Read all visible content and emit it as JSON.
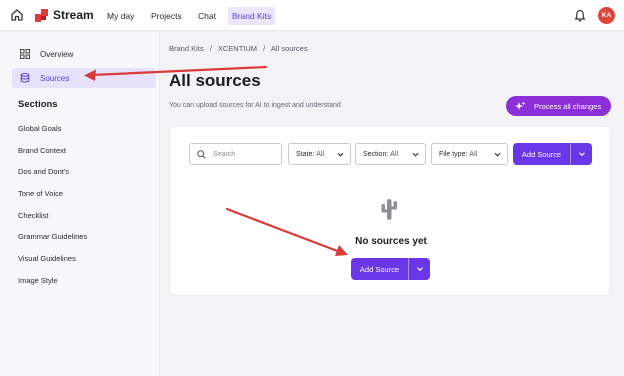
{
  "topbar": {
    "app_name": "Stream",
    "nav": [
      {
        "label": "My day"
      },
      {
        "label": "Projects"
      },
      {
        "label": "Chat"
      },
      {
        "label": "Brand Kits"
      }
    ],
    "active_nav": "Brand Kits",
    "avatar_initials": "KA",
    "avatar_color": "#e0453a"
  },
  "sidebar": {
    "links": [
      {
        "label": "Overview",
        "icon": "grid-icon"
      },
      {
        "label": "Sources",
        "icon": "database-icon"
      }
    ],
    "active_link": "Sources",
    "sections_title": "Sections",
    "sections": [
      "Global Goals",
      "Brand Context",
      "Dos and Dont's",
      "Tone of Voice",
      "Checklist",
      "Grammar Guidelines",
      "Visual Guidelines",
      "Image Style"
    ]
  },
  "main": {
    "breadcrumb": [
      "Brand Kits",
      "/",
      "XCENTIUM",
      "/",
      "All sources"
    ],
    "title": "All sources",
    "subtitle": "You can upload sources for AI to ingest and understand",
    "process_button": "Process all changes",
    "search_placeholder": "Search",
    "filters": [
      {
        "label": "State:",
        "value": "All"
      },
      {
        "label": "Section:",
        "value": "All"
      },
      {
        "label": "File type:",
        "value": "All"
      }
    ],
    "add_source_label": "Add Source",
    "empty_text": "No sources yet"
  },
  "colors": {
    "accent": "#6b35e8",
    "process_button": "#8b2fd9",
    "annotation_arrow": "#d93a3a"
  }
}
